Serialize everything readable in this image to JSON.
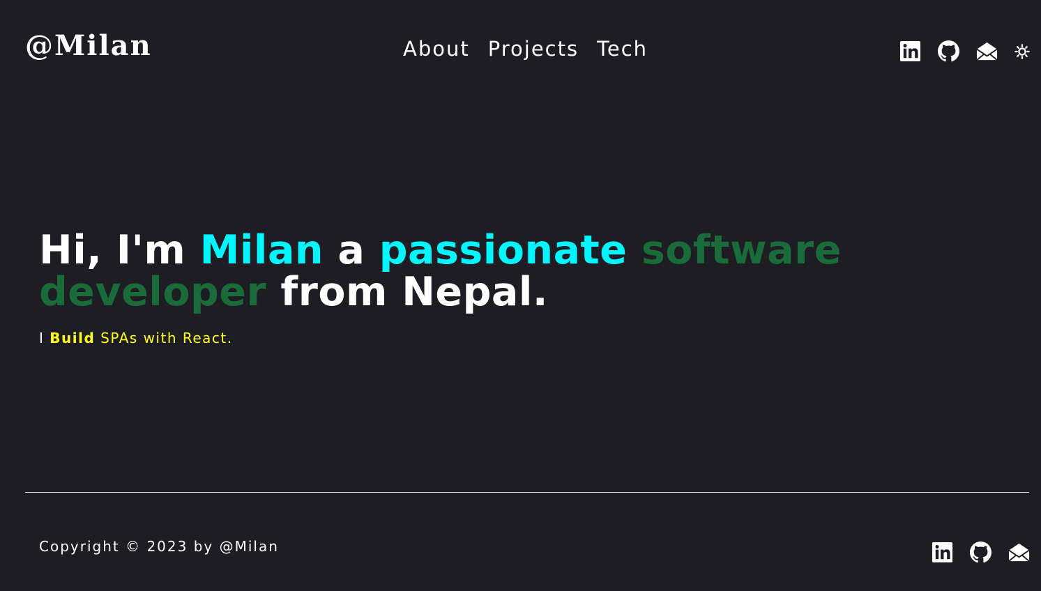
{
  "header": {
    "logo": "@Milan",
    "nav": [
      {
        "label": "About"
      },
      {
        "label": "Projects"
      },
      {
        "label": "Tech"
      }
    ],
    "social_icons": [
      "linkedin-icon",
      "github-icon",
      "mail-icon"
    ],
    "theme_icon": "sun-icon"
  },
  "hero": {
    "title_parts": {
      "greeting": "Hi, I'm",
      "name": "Milan",
      "a": "a",
      "passionate": "passionate",
      "role": "software developer",
      "origin": "from Nepal."
    },
    "subtitle": {
      "lead": "I",
      "emphasis": "Build",
      "rest": "SPAs with React."
    }
  },
  "footer": {
    "copyright": "Copyright © 2023 by @Milan",
    "social_icons": [
      "linkedin-icon",
      "github-icon",
      "mail-icon"
    ]
  },
  "colors": {
    "background": "#1e1d23",
    "accent_cyan": "#00f7ff",
    "accent_green": "#1a6b3a",
    "accent_yellow": "#ffff1a",
    "text": "#ffffff"
  }
}
